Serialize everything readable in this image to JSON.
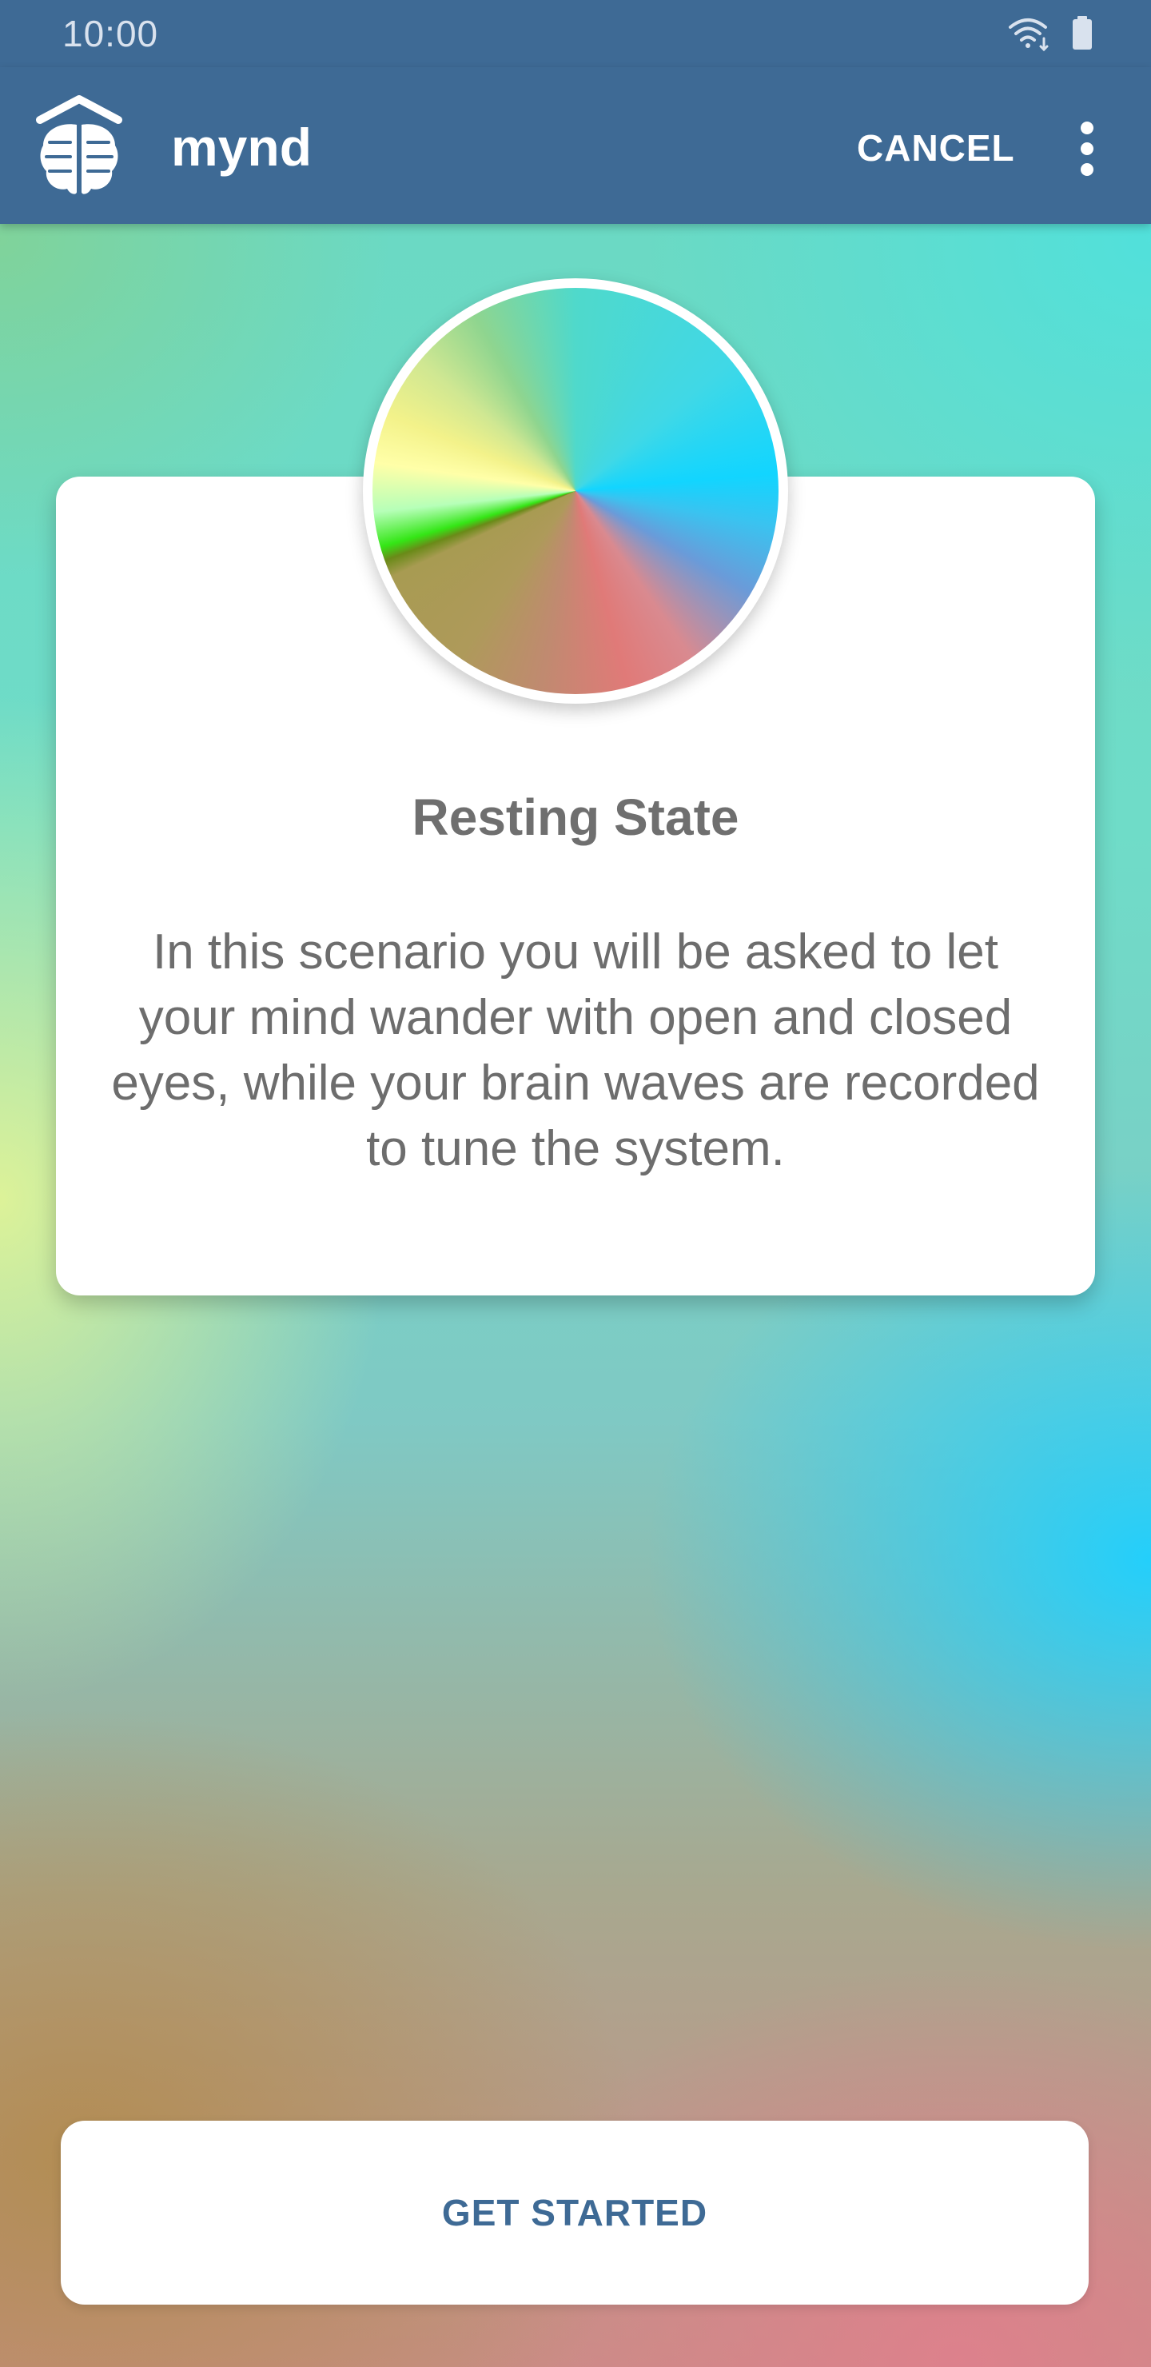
{
  "status_bar": {
    "time": "10:00",
    "icons": [
      "wifi-icon",
      "battery-icon"
    ]
  },
  "app_bar": {
    "title": "mynd",
    "logo_icon": "brain-logo-icon",
    "cancel_label": "CANCEL",
    "overflow_icon": "more-vert-icon"
  },
  "card": {
    "title": "Resting State",
    "body": "In this scenario you will be asked to let your mind wander with open and closed eyes, while your brain waves are recorded to tune the system.",
    "image_icon": "color-wheel-icon"
  },
  "actions": {
    "get_started_label": "GET STARTED"
  },
  "colors": {
    "app_bar": "#3e6a95",
    "card_background": "#ffffff",
    "card_text": "#6f6f6f",
    "button_text": "#3e6a95"
  }
}
